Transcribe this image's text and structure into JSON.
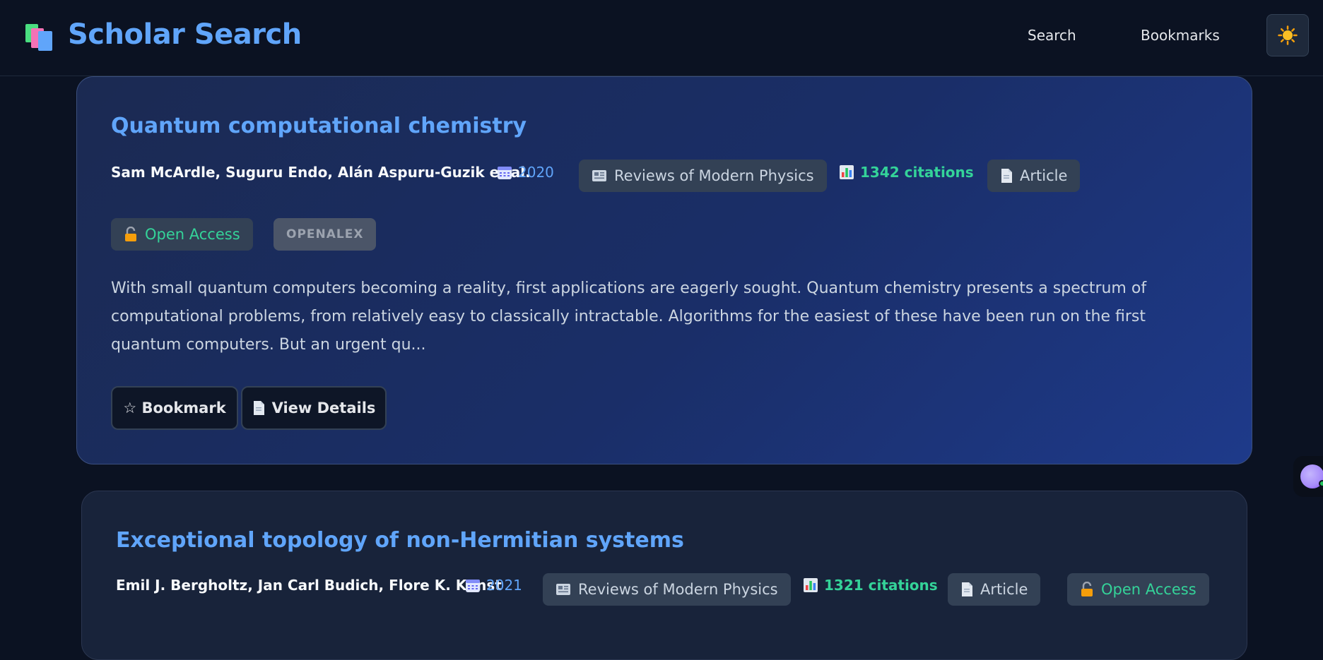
{
  "app": {
    "title": "Scholar Search",
    "logo_icon": "books-icon",
    "nav": [
      {
        "label": "Search"
      },
      {
        "label": "Bookmarks"
      }
    ],
    "theme_icon": "sun-icon"
  },
  "results": [
    {
      "title": "Quantum computational chemistry",
      "authors": "Sam McArdle, Suguru Endo, Alán Aspuru-Guzik et al.",
      "year": "2020",
      "journal": "Reviews of Modern Physics",
      "citations": "1342 citations",
      "type": "Article",
      "access": "Open Access",
      "source": "OPENALEX",
      "abstract": "With small quantum computers becoming a reality, first applications are eagerly sought. Quantum chemistry presents a spectrum of computational problems, from relatively easy to classically intractable. Algorithms for the easiest of these have been run on the first quantum computers. But an urgent qu...",
      "bookmark_label": "☆ Bookmark",
      "details_label": "View Details"
    },
    {
      "title": "Exceptional topology of non-Hermitian systems",
      "authors": "Emil J. Bergholtz, Jan Carl Budich, Flore K. Kunst",
      "year": "2021",
      "journal": "Reviews of Modern Physics",
      "citations": "1321 citations",
      "type": "Article",
      "access": "Open Access"
    }
  ],
  "colors": {
    "accent": "#60a5fa",
    "success": "#34d399",
    "background": "#0b1222"
  }
}
